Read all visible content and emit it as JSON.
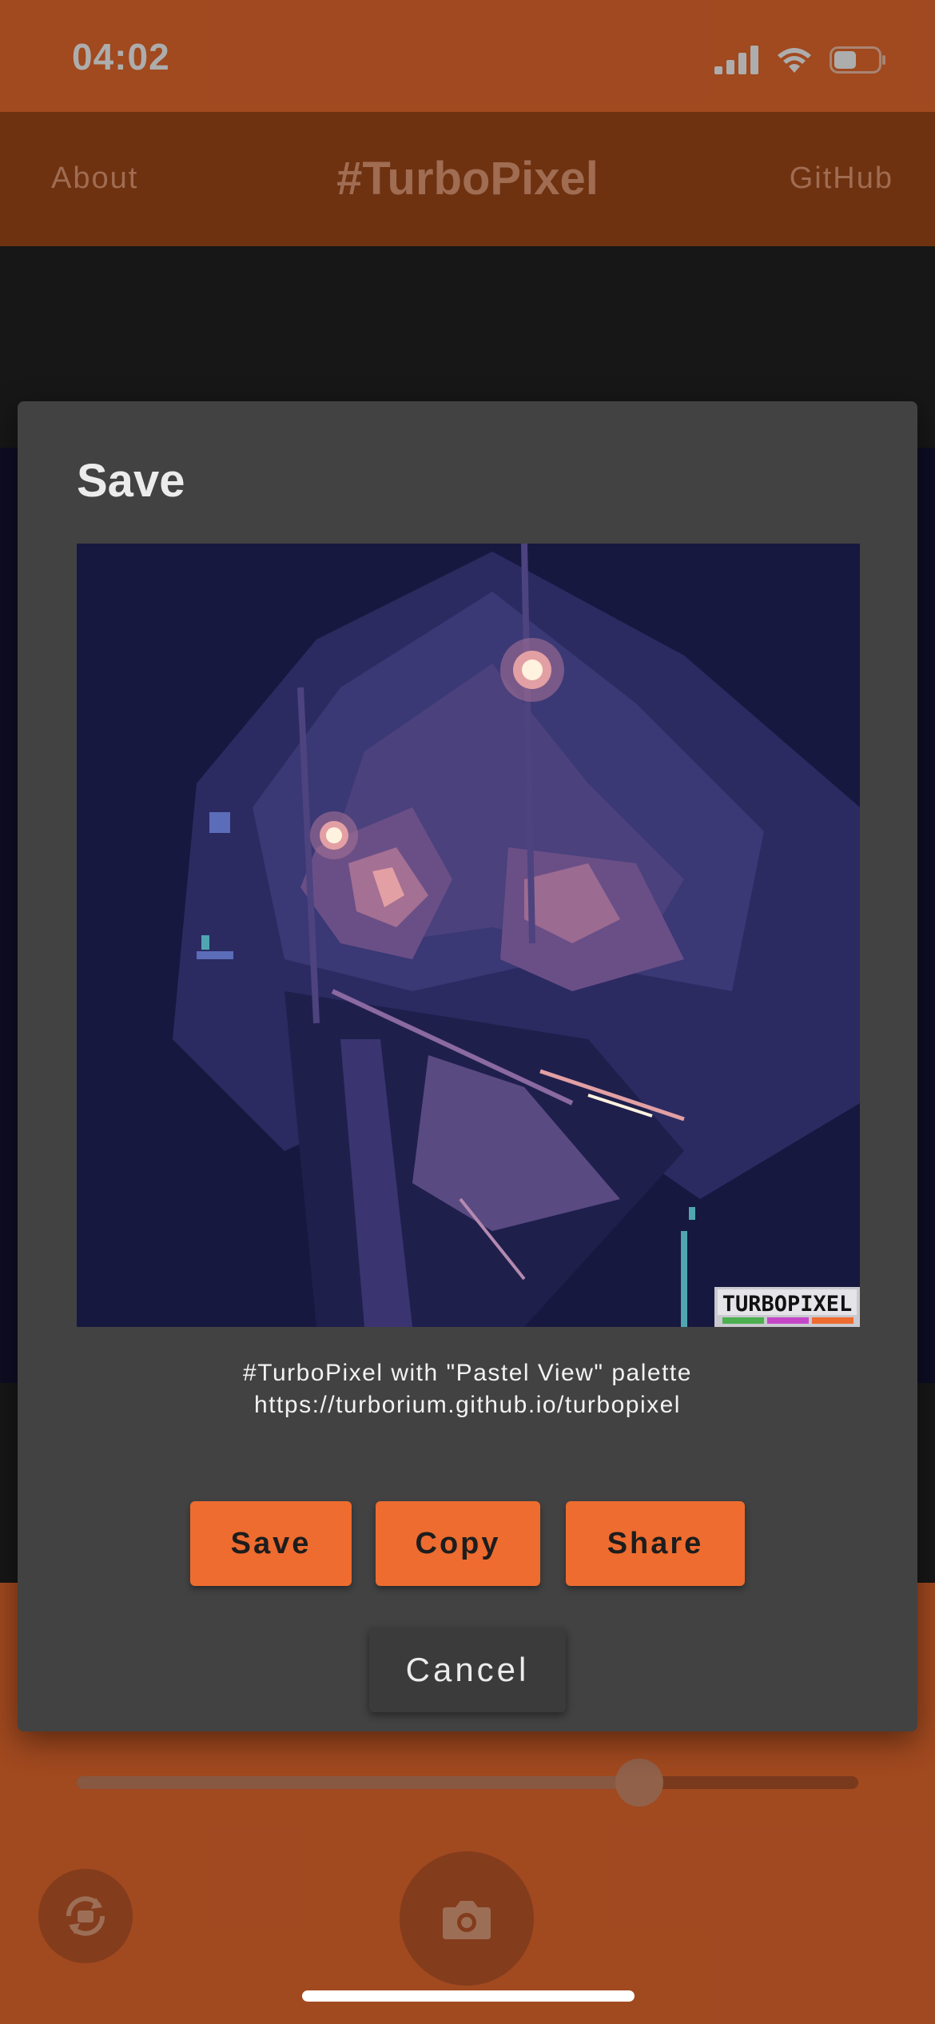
{
  "status_bar": {
    "time": "04:02",
    "battery_level": 0.5
  },
  "app_bar": {
    "left_link": "About",
    "title": "#TurboPixel",
    "right_link": "GitHub"
  },
  "slider": {
    "value": 0.72
  },
  "dialog": {
    "title": "Save",
    "preview": {
      "watermark": "TURBOPIXEL",
      "palette_colors": [
        "#17183f",
        "#3c3a78",
        "#6a4f86",
        "#a47094",
        "#e2a0a4",
        "#fff2de",
        "#4fa6b0"
      ]
    },
    "caption_line1": "#TurboPixel with \"Pastel View\" palette",
    "caption_line2": "https://turborium.github.io/turbopixel",
    "buttons": {
      "save": "Save",
      "copy": "Copy",
      "share": "Share",
      "cancel": "Cancel"
    }
  },
  "icons": {
    "signal": "signal-icon",
    "wifi": "wifi-icon",
    "battery": "battery-icon",
    "rotate": "rotate-camera-icon",
    "camera": "camera-icon"
  },
  "colors": {
    "accent": "#ee6c2f",
    "app_bar": "#a24b1a",
    "dialog": "#424242"
  }
}
